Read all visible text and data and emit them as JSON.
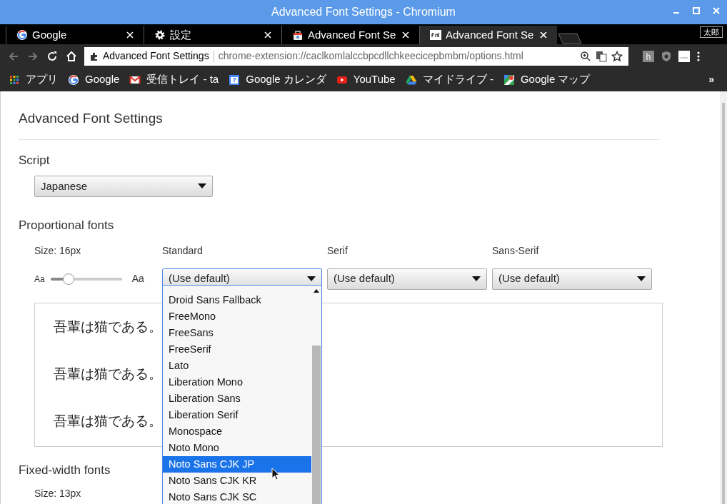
{
  "window": {
    "title": "Advanced Font Settings - Chromium"
  },
  "tabs": [
    {
      "kind": "google",
      "label": "Google",
      "selected": false
    },
    {
      "kind": "gear",
      "label": "設定",
      "selected": false
    },
    {
      "kind": "store",
      "label": "Advanced Font Se",
      "selected": false
    },
    {
      "kind": "font",
      "label": "Advanced Font Se",
      "selected": true
    }
  ],
  "profile": "太郎",
  "omnibox": {
    "page_title": "Advanced Font Settings",
    "url": "chrome-extension://caclkomlalccbpcdllchkeecicepbmbm/options.html"
  },
  "bookmarks": [
    {
      "kind": "apps",
      "label": "アプリ"
    },
    {
      "kind": "google",
      "label": "Google"
    },
    {
      "kind": "gmail",
      "label": "受信トレイ - ta"
    },
    {
      "kind": "calendar",
      "label": "Google カレンダ"
    },
    {
      "kind": "youtube",
      "label": "YouTube"
    },
    {
      "kind": "drive",
      "label": "マイドライブ - "
    },
    {
      "kind": "maps",
      "label": "Google マップ"
    }
  ],
  "bookmarks_overflow": "»",
  "page": {
    "heading": "Advanced Font Settings",
    "script": {
      "label": "Script",
      "value": "Japanese"
    },
    "proportional": {
      "heading": "Proportional fonts",
      "size_label": "Size: 16px",
      "small_sample": "Aa",
      "large_sample": "Aa",
      "level": 0.25,
      "columns": [
        {
          "label": "Standard",
          "value": "(Use default)",
          "open": true
        },
        {
          "label": "Serif",
          "value": "(Use default)",
          "open": false
        },
        {
          "label": "Sans-Serif",
          "value": "(Use default)",
          "open": false
        }
      ],
      "previews": [
        "吾輩は猫である。",
        "吾輩は猫である。",
        "吾輩は猫である。"
      ]
    },
    "fixed": {
      "heading": "Fixed-width fonts",
      "size_label": "Size: 13px"
    }
  },
  "dropdown_options": [
    {
      "label": "Droid Sans Fallback",
      "selected": false
    },
    {
      "label": "FreeMono",
      "selected": false
    },
    {
      "label": "FreeSans",
      "selected": false
    },
    {
      "label": "FreeSerif",
      "selected": false
    },
    {
      "label": "Lato",
      "selected": false
    },
    {
      "label": "Liberation Mono",
      "selected": false
    },
    {
      "label": "Liberation Sans",
      "selected": false
    },
    {
      "label": "Liberation Serif",
      "selected": false
    },
    {
      "label": "Monospace",
      "selected": false
    },
    {
      "label": "Noto Mono",
      "selected": false
    },
    {
      "label": "Noto Sans CJK JP",
      "selected": true
    },
    {
      "label": "Noto Sans CJK KR",
      "selected": false
    },
    {
      "label": "Noto Sans CJK SC",
      "selected": false
    }
  ]
}
